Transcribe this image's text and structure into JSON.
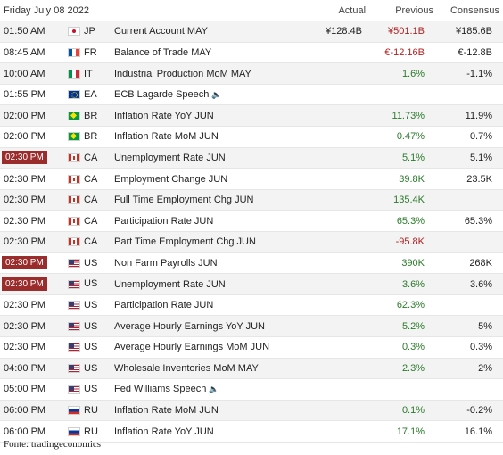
{
  "header": {
    "date": "Friday July 08 2022",
    "actual": "Actual",
    "previous": "Previous",
    "consensus": "Consensus"
  },
  "colors": {
    "highlight": "#9b2c2c",
    "positive": "#2a7a2a",
    "negative": "#b02020"
  },
  "rows": [
    {
      "time": "01:50 AM",
      "hl": false,
      "country": "JP",
      "flag": "flag-jp",
      "event": "Current Account MAY",
      "speech": false,
      "actual": "¥128.4B",
      "previous": "¥501.1B",
      "prev_color": "red",
      "consensus": "¥185.6B"
    },
    {
      "time": "08:45 AM",
      "hl": false,
      "country": "FR",
      "flag": "flag-fr",
      "event": "Balance of Trade MAY",
      "speech": false,
      "actual": "",
      "previous": "€-12.16B",
      "prev_color": "red",
      "consensus": "€-12.8B"
    },
    {
      "time": "10:00 AM",
      "hl": false,
      "country": "IT",
      "flag": "flag-it",
      "event": "Industrial Production MoM MAY",
      "speech": false,
      "actual": "",
      "previous": "1.6%",
      "prev_color": "green",
      "consensus": "-1.1%"
    },
    {
      "time": "01:55 PM",
      "hl": false,
      "country": "EA",
      "flag": "flag-ea",
      "event": "ECB Lagarde Speech",
      "speech": true,
      "actual": "",
      "previous": "",
      "prev_color": "plain",
      "consensus": ""
    },
    {
      "time": "02:00 PM",
      "hl": false,
      "country": "BR",
      "flag": "flag-br",
      "event": "Inflation Rate YoY JUN",
      "speech": false,
      "actual": "",
      "previous": "11.73%",
      "prev_color": "green",
      "consensus": "11.9%"
    },
    {
      "time": "02:00 PM",
      "hl": false,
      "country": "BR",
      "flag": "flag-br",
      "event": "Inflation Rate MoM JUN",
      "speech": false,
      "actual": "",
      "previous": "0.47%",
      "prev_color": "green",
      "consensus": "0.7%"
    },
    {
      "time": "02:30 PM",
      "hl": true,
      "country": "CA",
      "flag": "flag-ca",
      "event": "Unemployment Rate JUN",
      "speech": false,
      "actual": "",
      "previous": "5.1%",
      "prev_color": "green",
      "consensus": "5.1%"
    },
    {
      "time": "02:30 PM",
      "hl": false,
      "country": "CA",
      "flag": "flag-ca",
      "event": "Employment Change JUN",
      "speech": false,
      "actual": "",
      "previous": "39.8K",
      "prev_color": "green",
      "consensus": "23.5K"
    },
    {
      "time": "02:30 PM",
      "hl": false,
      "country": "CA",
      "flag": "flag-ca",
      "event": "Full Time Employment Chg JUN",
      "speech": false,
      "actual": "",
      "previous": "135.4K",
      "prev_color": "green",
      "consensus": ""
    },
    {
      "time": "02:30 PM",
      "hl": false,
      "country": "CA",
      "flag": "flag-ca",
      "event": "Participation Rate JUN",
      "speech": false,
      "actual": "",
      "previous": "65.3%",
      "prev_color": "green",
      "consensus": "65.3%"
    },
    {
      "time": "02:30 PM",
      "hl": false,
      "country": "CA",
      "flag": "flag-ca",
      "event": "Part Time Employment Chg JUN",
      "speech": false,
      "actual": "",
      "previous": "-95.8K",
      "prev_color": "red",
      "consensus": ""
    },
    {
      "time": "02:30 PM",
      "hl": true,
      "country": "US",
      "flag": "flag-us",
      "event": "Non Farm Payrolls JUN",
      "speech": false,
      "actual": "",
      "previous": "390K",
      "prev_color": "green",
      "consensus": "268K"
    },
    {
      "time": "02:30 PM",
      "hl": true,
      "country": "US",
      "flag": "flag-us",
      "event": "Unemployment Rate JUN",
      "speech": false,
      "actual": "",
      "previous": "3.6%",
      "prev_color": "green",
      "consensus": "3.6%"
    },
    {
      "time": "02:30 PM",
      "hl": false,
      "country": "US",
      "flag": "flag-us",
      "event": "Participation Rate JUN",
      "speech": false,
      "actual": "",
      "previous": "62.3%",
      "prev_color": "green",
      "consensus": ""
    },
    {
      "time": "02:30 PM",
      "hl": false,
      "country": "US",
      "flag": "flag-us",
      "event": "Average Hourly Earnings YoY JUN",
      "speech": false,
      "actual": "",
      "previous": "5.2%",
      "prev_color": "green",
      "consensus": "5%"
    },
    {
      "time": "02:30 PM",
      "hl": false,
      "country": "US",
      "flag": "flag-us",
      "event": "Average Hourly Earnings MoM JUN",
      "speech": false,
      "actual": "",
      "previous": "0.3%",
      "prev_color": "green",
      "consensus": "0.3%"
    },
    {
      "time": "04:00 PM",
      "hl": false,
      "country": "US",
      "flag": "flag-us",
      "event": "Wholesale Inventories MoM MAY",
      "speech": false,
      "actual": "",
      "previous": "2.3%",
      "prev_color": "green",
      "consensus": "2%"
    },
    {
      "time": "05:00 PM",
      "hl": false,
      "country": "US",
      "flag": "flag-us",
      "event": "Fed Williams Speech",
      "speech": true,
      "actual": "",
      "previous": "",
      "prev_color": "plain",
      "consensus": ""
    },
    {
      "time": "06:00 PM",
      "hl": false,
      "country": "RU",
      "flag": "flag-ru",
      "event": "Inflation Rate MoM JUN",
      "speech": false,
      "actual": "",
      "previous": "0.1%",
      "prev_color": "green",
      "consensus": "-0.2%"
    },
    {
      "time": "06:00 PM",
      "hl": false,
      "country": "RU",
      "flag": "flag-ru",
      "event": "Inflation Rate YoY JUN",
      "speech": false,
      "actual": "",
      "previous": "17.1%",
      "prev_color": "green",
      "consensus": "16.1%"
    }
  ],
  "source": "Fonte: tradingeconomics"
}
